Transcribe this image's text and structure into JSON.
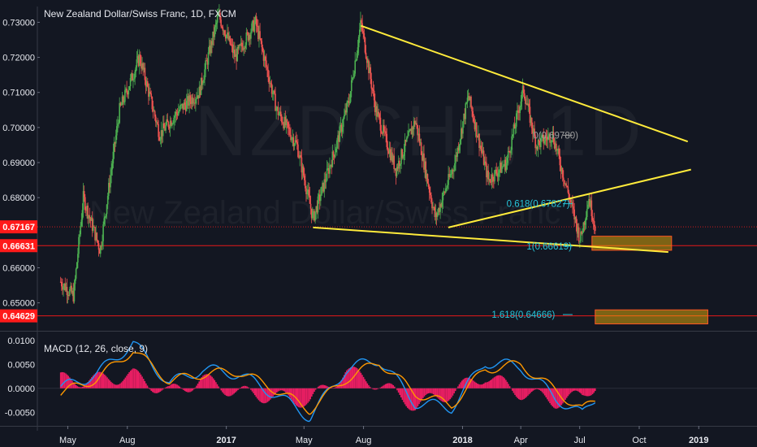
{
  "header": {
    "title": "New Zealand Dollar/Swiss Franc, 1D, FXCM"
  },
  "watermark": {
    "symbol": "NZDCHF, 1D",
    "name": "New Zealand Dollar/Swiss Franc"
  },
  "macd": {
    "title": "MACD (12, 26, close, 9)",
    "ticks": [
      "0.0100",
      "0.0050",
      "0.0000",
      "-0.0050"
    ]
  },
  "colors": {
    "background": "#131722",
    "up": "#4caf50",
    "down": "#ef5350",
    "trendline": "#ffeb3b",
    "fib": "#26c6da",
    "level": "#ff1a1a",
    "macd_line": "#2196f3",
    "signal_line": "#ff9800",
    "histogram": "#e91e63"
  },
  "chart_data": {
    "type": "candlestick",
    "title": "New Zealand Dollar/Swiss Franc, 1D, FXCM",
    "x_labels": [
      "May",
      "Aug",
      "2017",
      "May",
      "Aug",
      "2018",
      "Apr",
      "Jul",
      "Oct",
      "2019"
    ],
    "y_ticks": [
      "0.73000",
      "0.72000",
      "0.71000",
      "0.70000",
      "0.69000",
      "0.68000",
      "0.66000",
      "0.65000"
    ],
    "ylim": [
      0.6425,
      0.7345
    ],
    "price_path": [
      [
        "2016-04-20",
        0.656
      ],
      [
        "2016-05-10",
        0.652
      ],
      [
        "2016-05-25",
        0.68
      ],
      [
        "2016-06-20",
        0.665
      ],
      [
        "2016-07-20",
        0.705
      ],
      [
        "2016-08-20",
        0.72
      ],
      [
        "2016-09-20",
        0.698
      ],
      [
        "2016-10-20",
        0.705
      ],
      [
        "2016-11-20",
        0.71
      ],
      [
        "2016-12-20",
        0.732
      ],
      [
        "2017-01-15",
        0.72
      ],
      [
        "2017-02-15",
        0.73
      ],
      [
        "2017-03-20",
        0.705
      ],
      [
        "2017-04-20",
        0.695
      ],
      [
        "2017-05-15",
        0.674
      ],
      [
        "2017-06-20",
        0.695
      ],
      [
        "2017-07-10",
        0.708
      ],
      [
        "2017-07-28",
        0.73
      ],
      [
        "2017-08-20",
        0.705
      ],
      [
        "2017-09-20",
        0.688
      ],
      [
        "2017-10-20",
        0.702
      ],
      [
        "2017-11-20",
        0.674
      ],
      [
        "2017-12-20",
        0.69
      ],
      [
        "2018-01-10",
        0.709
      ],
      [
        "2018-02-10",
        0.685
      ],
      [
        "2018-03-10",
        0.69
      ],
      [
        "2018-04-05",
        0.711
      ],
      [
        "2018-04-25",
        0.695
      ],
      [
        "2018-05-20",
        0.698
      ],
      [
        "2018-06-15",
        0.68
      ],
      [
        "2018-07-02",
        0.668
      ],
      [
        "2018-07-15",
        0.68
      ],
      [
        "2018-07-25",
        0.672
      ]
    ],
    "price_labels": [
      {
        "text": "0.67167",
        "value": 0.67167,
        "color": "#ff1a1a"
      },
      {
        "text": "0.66631",
        "value": 0.66631,
        "color": "#ff1a1a"
      },
      {
        "text": "0.64629",
        "value": 0.64629,
        "color": "#ff1a1a"
      }
    ],
    "horizontal_levels": [
      {
        "value": 0.67167,
        "style": "dotted"
      },
      {
        "value": 0.66631,
        "style": "solid"
      },
      {
        "value": 0.64629,
        "style": "solid"
      }
    ],
    "trendlines": [
      {
        "from": [
          "2017-07-28",
          0.729
        ],
        "to": [
          "2018-12-15",
          0.696
        ]
      },
      {
        "from": [
          "2017-05-15",
          0.6715
        ],
        "to": [
          "2018-11-15",
          0.6645
        ]
      },
      {
        "from": [
          "2017-12-10",
          0.6715
        ],
        "to": [
          "2018-12-20",
          0.688
        ]
      }
    ],
    "fib_labels": [
      {
        "text": "0(0.69780)",
        "value": 0.6978,
        "color": "#9e9e9e"
      },
      {
        "text": "0.618(0.67827)",
        "value": 0.67827,
        "color": "#26c6da"
      },
      {
        "text": "1(0.66619)",
        "value": 0.66619,
        "color": "#26c6da"
      },
      {
        "text": "1.618(0.64666)",
        "value": 0.64666,
        "color": "#26c6da"
      }
    ],
    "target_boxes": [
      {
        "from": "2018-07-20",
        "to": "2018-11-20",
        "top": 0.669,
        "bottom": 0.665
      },
      {
        "from": "2018-07-25",
        "to": "2019-01-15",
        "top": 0.648,
        "bottom": 0.644
      }
    ],
    "macd_series": {
      "ylim": [
        -0.0075,
        0.0115
      ],
      "dates": [
        "2016-04-20",
        "2016-06-15",
        "2016-08-10",
        "2016-10-05",
        "2016-11-25",
        "2017-01-20",
        "2017-03-15",
        "2017-05-10",
        "2017-07-05",
        "2017-08-25",
        "2017-10-20",
        "2017-12-15",
        "2018-02-05",
        "2018-04-01",
        "2018-05-25",
        "2018-07-05",
        "2018-07-25"
      ],
      "macd": [
        0.0,
        0.003,
        0.0095,
        0.001,
        0.004,
        0.003,
        -0.001,
        -0.006,
        0.004,
        0.006,
        -0.003,
        -0.004,
        0.0055,
        0.0045,
        -0.002,
        -0.0055,
        -0.002
      ],
      "signal": [
        -0.001,
        0.002,
        0.008,
        0.0015,
        0.003,
        0.0035,
        0.0,
        -0.0045,
        0.002,
        0.0055,
        -0.001,
        -0.0035,
        0.004,
        0.005,
        -0.0005,
        -0.0045,
        -0.0025
      ]
    }
  }
}
